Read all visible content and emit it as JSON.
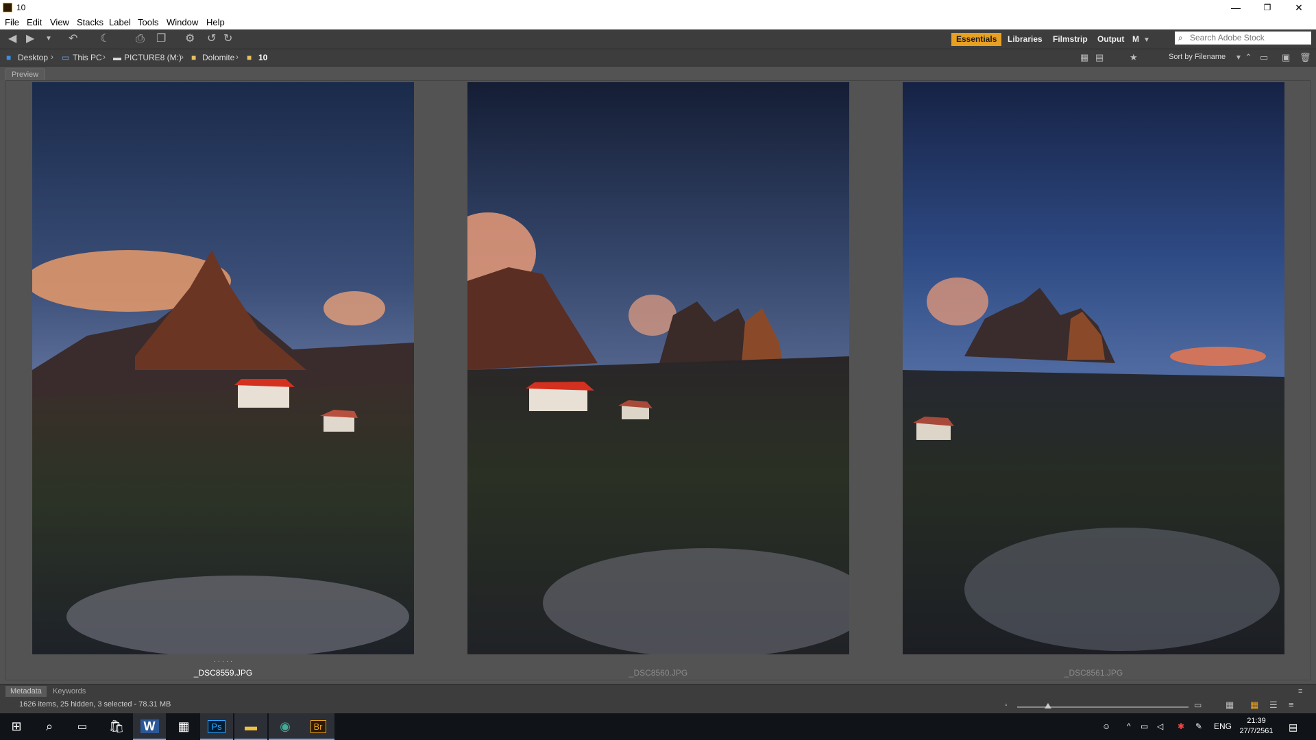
{
  "window": {
    "title": "10",
    "minimize": "—",
    "restore": "❐",
    "close": "✕"
  },
  "menu": [
    "File",
    "Edit",
    "View",
    "Stacks",
    "Label",
    "Tools",
    "Window",
    "Help"
  ],
  "toolbar": {
    "icons": [
      "back-arrow-icon",
      "forward-arrow-icon",
      "recent-dropdown-icon",
      "boomerang-icon",
      "camera-import-icon",
      "copy-icon",
      "refine-icon",
      "rotate-left-icon",
      "rotate-right-icon"
    ],
    "workspaces": [
      {
        "label": "Essentials",
        "active": true
      },
      {
        "label": "Libraries",
        "active": false
      },
      {
        "label": "Filmstrip",
        "active": false
      },
      {
        "label": "Output",
        "active": false
      },
      {
        "label": "M",
        "active": false
      }
    ],
    "search_placeholder": "Search Adobe Stock",
    "sort_label": "Sort by Filename"
  },
  "path": [
    {
      "label": "Desktop",
      "icon": "folder-blue-icon"
    },
    {
      "label": "This PC",
      "icon": "pc-icon"
    },
    {
      "label": "PICTURE8 (M:)",
      "icon": "drive-icon"
    },
    {
      "label": "Dolomite",
      "icon": "folder-icon"
    },
    {
      "label": "10",
      "icon": "folder-icon",
      "current": true
    }
  ],
  "panel_tab": "Preview",
  "photos": [
    {
      "filename": "_DSC8559.JPG",
      "selected": true
    },
    {
      "filename": "_DSC8560.JPG",
      "selected": false
    },
    {
      "filename": "_DSC8561.JPG",
      "selected": false
    }
  ],
  "rating_dots": "· · · · ·",
  "meta_tabs": [
    "Metadata",
    "Keywords"
  ],
  "status": "1626 items, 25 hidden, 3 selected - 78.31 MB",
  "taskbar": {
    "apps": [
      "windows-start-icon",
      "search-icon",
      "task-view-icon",
      "store-icon",
      "word-icon",
      "calculator-icon",
      "photoshop-icon",
      "file-explorer-icon",
      "chrome-icon",
      "bridge-icon"
    ],
    "labels": {
      "word": "W",
      "photoshop": "Ps",
      "bridge": "Br"
    },
    "lang": "ENG",
    "time": "21:39",
    "date": "27/7/2561"
  },
  "colors": {
    "accent": "#e8a020",
    "panel": "#3d3d3d",
    "background": "#535353"
  }
}
